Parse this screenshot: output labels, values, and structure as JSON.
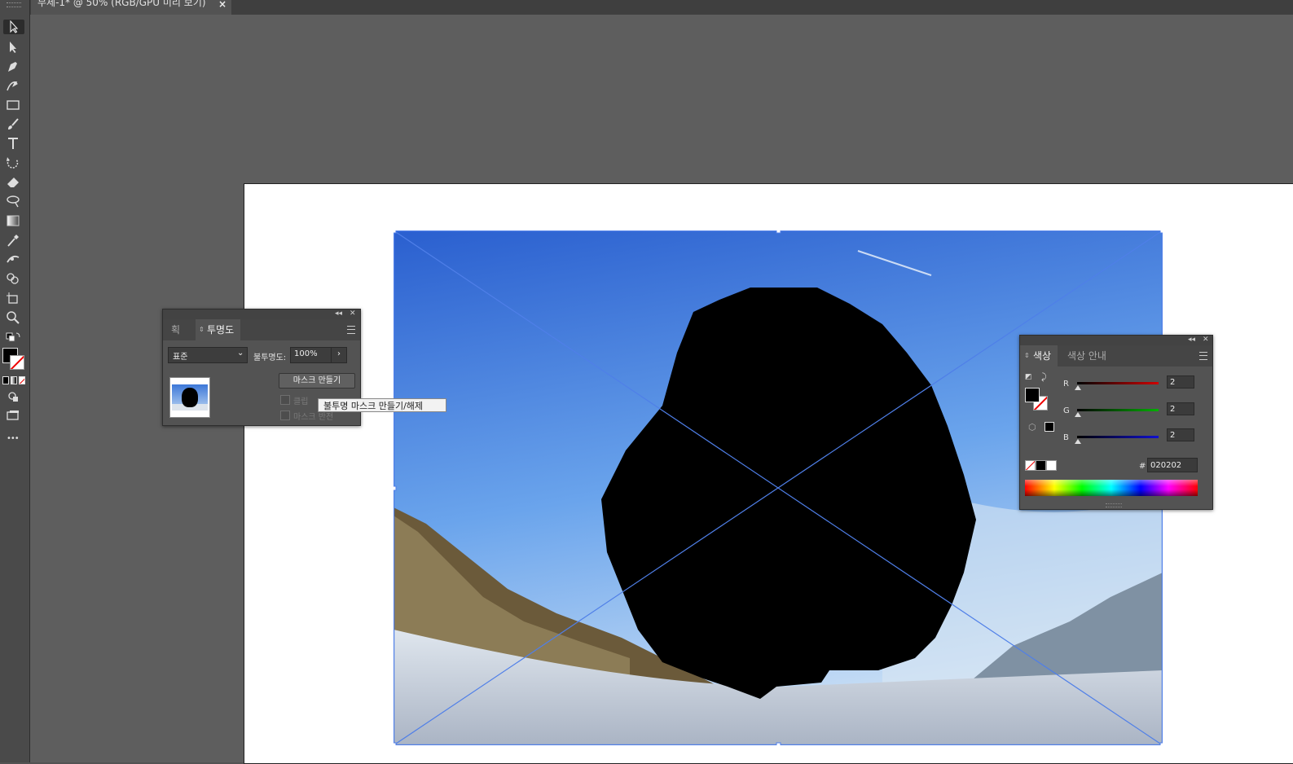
{
  "document": {
    "tab_title": "무제-1* @ 50% (RGB/GPU 미리 보기)",
    "close_glyph": "×"
  },
  "toolbar": {
    "tools": [
      "selection-tool",
      "direct-selection-tool",
      "pen-tool",
      "curvature-tool",
      "rectangle-tool",
      "paintbrush-tool",
      "type-tool",
      "rotate-tool",
      "eraser-tool",
      "lasso-tool",
      "gradient-tool",
      "eyedropper-tool",
      "width-tool",
      "shape-builder-tool",
      "artboard-tool",
      "zoom-tool"
    ],
    "more_glyph": "•••"
  },
  "transparency_panel": {
    "tab_stroke": "획",
    "tab_transparency": "투명도",
    "blend_mode": "표준",
    "opacity_label": "불투명도:",
    "opacity_value": "100%",
    "make_mask_button": "마스크 만들기",
    "clip_label": "클립",
    "invert_label": "마스크 반전",
    "tooltip": "불투명 마스크 만들기/해제"
  },
  "color_panel": {
    "tab_color": "색상",
    "tab_color_guide": "색상 안내",
    "channels": [
      {
        "label": "R",
        "value": "2",
        "color": "#d00000"
      },
      {
        "label": "G",
        "value": "2",
        "color": "#00b000"
      },
      {
        "label": "B",
        "value": "2",
        "color": "#1010d0"
      }
    ],
    "hex_label": "#",
    "hex_value": "020202"
  },
  "colors": {
    "fill": "#000000",
    "selection": "#4f7fe8",
    "sky_top": "#2a63d4",
    "sky_bottom": "#a9cbf2"
  }
}
